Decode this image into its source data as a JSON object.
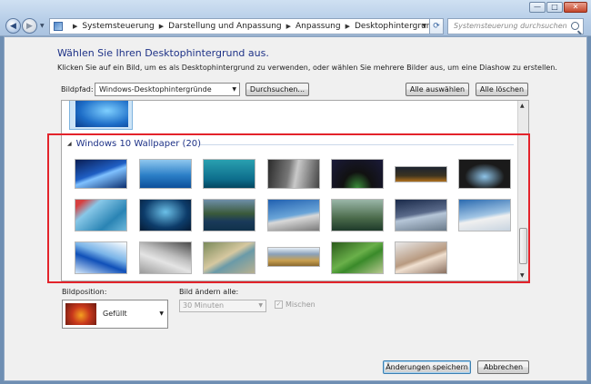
{
  "window": {
    "min_glyph": "—",
    "max_glyph": "□",
    "close_glyph": "✕"
  },
  "address": {
    "crumbs": [
      "Systemsteuerung",
      "Darstellung und Anpassung",
      "Anpassung",
      "Desktophintergrund"
    ],
    "search_placeholder": "Systemsteuerung durchsuchen"
  },
  "page": {
    "heading": "Wählen Sie Ihren Desktophintergrund aus.",
    "description": "Klicken Sie auf ein Bild, um es als Desktophintergrund zu verwenden, oder wählen Sie mehrere Bilder aus, um eine Diashow zu erstellen."
  },
  "picture_location": {
    "label": "Bildpfad:",
    "value": "Windows-Desktophintergründe",
    "browse_label": "Durchsuchen...",
    "select_all_label": "Alle auswählen",
    "clear_all_label": "Alle löschen"
  },
  "gallery": {
    "group_title": "Windows 10 Wallpaper (20)",
    "thumbnail_count": 20
  },
  "position": {
    "label": "Bildposition:",
    "value": "Gefüllt"
  },
  "interval": {
    "label": "Bild ändern alle:",
    "value": "30 Minuten"
  },
  "shuffle": {
    "label": "Mischen",
    "checked": true
  },
  "footer": {
    "save_label": "Änderungen speichern",
    "cancel_label": "Abbrechen"
  },
  "colors": {
    "highlight": "#e3232b",
    "heading": "#1e3287"
  }
}
